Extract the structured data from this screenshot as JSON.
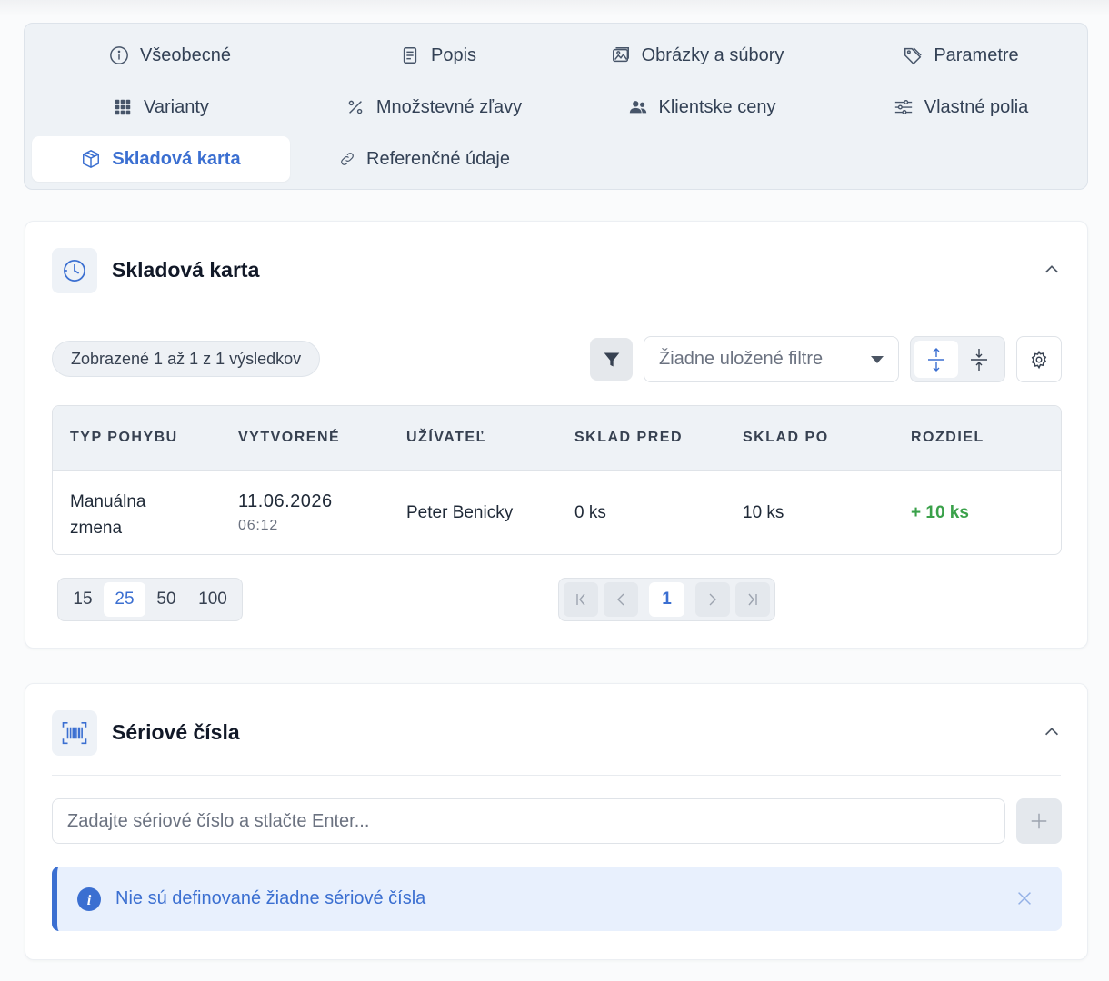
{
  "tabs": [
    {
      "label": "Všeobecné",
      "icon": "info-circle-icon"
    },
    {
      "label": "Popis",
      "icon": "document-icon"
    },
    {
      "label": "Obrázky a súbory",
      "icon": "images-icon"
    },
    {
      "label": "Parametre",
      "icon": "tag-icon"
    },
    {
      "label": "Varianty",
      "icon": "grid-icon"
    },
    {
      "label": "Množstevné zľavy",
      "icon": "percent-icon"
    },
    {
      "label": "Klientske ceny",
      "icon": "users-icon"
    },
    {
      "label": "Vlastné polia",
      "icon": "sliders-icon"
    },
    {
      "label": "Skladová karta",
      "icon": "box-icon",
      "active": true
    },
    {
      "label": "Referenčné údaje",
      "icon": "link-icon"
    }
  ],
  "stock_card": {
    "title": "Skladová karta",
    "results_label": "Zobrazené 1 až 1 z 1 výsledkov",
    "saved_filters_placeholder": "Žiadne uložené filtre",
    "columns": [
      "TYP POHYBU",
      "VYTVORENÉ",
      "UŽÍVATEĽ",
      "SKLAD PRED",
      "SKLAD PO",
      "ROZDIEL"
    ],
    "rows": [
      {
        "type_line1": "Manuálna",
        "type_line2": "zmena",
        "date": "11.06.2026",
        "time": "06:12",
        "user": "Peter Benicky",
        "before": "0 ks",
        "after": "10 ks",
        "diff": "+ 10 ks"
      }
    ],
    "page_sizes": [
      "15",
      "25",
      "50",
      "100"
    ],
    "selected_page_size": "25",
    "current_page": "1"
  },
  "serial": {
    "title": "Sériové čísla",
    "input_placeholder": "Zadajte sériové číslo a stlačte Enter...",
    "alert_text": "Nie sú definované žiadne sériové čísla"
  },
  "colors": {
    "accent": "#3b6fd1",
    "positive": "#3aa14a",
    "panel": "#eef2f6"
  }
}
